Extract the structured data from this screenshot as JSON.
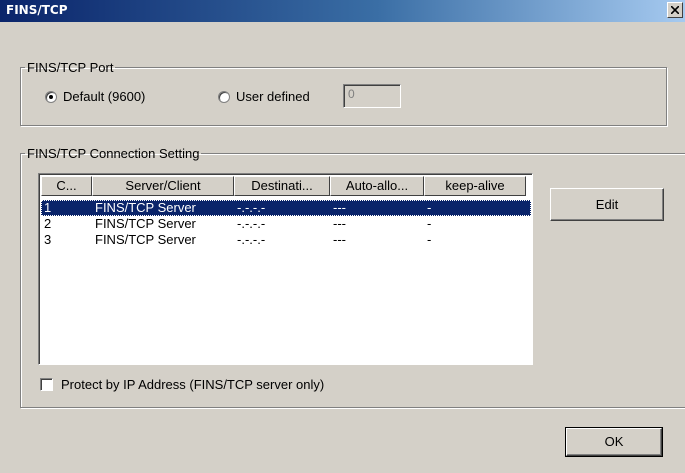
{
  "window": {
    "title": "FINS/TCP",
    "close_symbol": "X"
  },
  "port_group": {
    "legend": "FINS/TCP Port",
    "default_option": {
      "label": "Default (9600)",
      "selected": true
    },
    "user_option": {
      "label": "User defined",
      "selected": false
    },
    "user_value": "0"
  },
  "connection_group": {
    "legend": "FINS/TCP Connection Setting",
    "columns": [
      "C...",
      "Server/Client",
      "Destinati...",
      "Auto-allo...",
      "keep-alive"
    ],
    "rows": [
      {
        "c": "1",
        "server_client": "FINS/TCP Server",
        "destination": "-.-.-.-",
        "auto_alloc": "---",
        "keep_alive": "-",
        "selected": true
      },
      {
        "c": "2",
        "server_client": "FINS/TCP Server",
        "destination": "-.-.-.-",
        "auto_alloc": "---",
        "keep_alive": "-",
        "selected": false
      },
      {
        "c": "3",
        "server_client": "FINS/TCP Server",
        "destination": "-.-.-.-",
        "auto_alloc": "---",
        "keep_alive": "-",
        "selected": false
      }
    ],
    "edit_label": "Edit",
    "protect_label": "Protect by IP Address (FINS/TCP server only)",
    "protect_checked": false
  },
  "ok_label": "OK",
  "colors": {
    "title_bar": "#0a246a",
    "dialog_bg": "#d4d0c8",
    "selection": "#0a246a"
  }
}
